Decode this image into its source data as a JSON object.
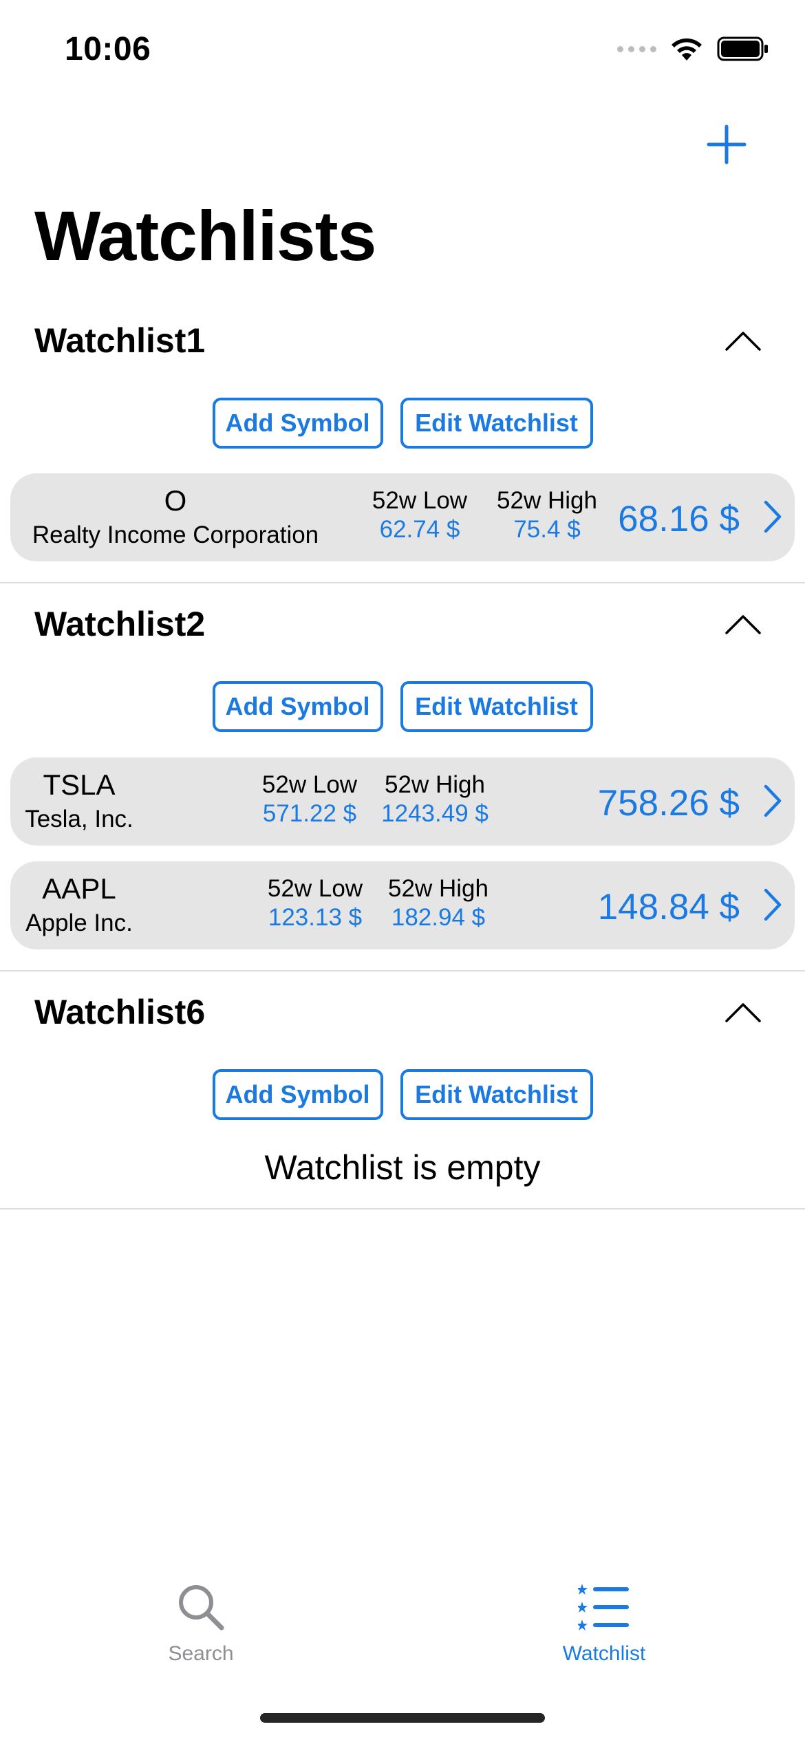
{
  "status": {
    "time": "10:06"
  },
  "page": {
    "title": "Watchlists"
  },
  "labels": {
    "low": "52w Low",
    "high": "52w High",
    "add_symbol": "Add Symbol",
    "edit_watchlist": "Edit Watchlist"
  },
  "watchlists": [
    {
      "name": "Watchlist1",
      "stocks": [
        {
          "symbol": "O",
          "name": "Realty Income Corporation",
          "low": "62.74 $",
          "high": "75.4 $",
          "price": "68.16 $"
        }
      ]
    },
    {
      "name": "Watchlist2",
      "stocks": [
        {
          "symbol": "TSLA",
          "name": "Tesla, Inc.",
          "low": "571.22 $",
          "high": "1243.49 $",
          "price": "758.26 $"
        },
        {
          "symbol": "AAPL",
          "name": "Apple Inc.",
          "low": "123.13 $",
          "high": "182.94 $",
          "price": "148.84 $"
        }
      ]
    },
    {
      "name": "Watchlist6",
      "stocks": [],
      "empty_text": "Watchlist is empty"
    }
  ],
  "tabs": [
    {
      "label": "Search",
      "icon": "search-icon",
      "active": false
    },
    {
      "label": "Watchlist",
      "icon": "list-icon",
      "active": true
    }
  ],
  "colors": {
    "accent": "#1a7ae2",
    "card": "#e5e5e5",
    "inactive": "#8e8e93"
  }
}
